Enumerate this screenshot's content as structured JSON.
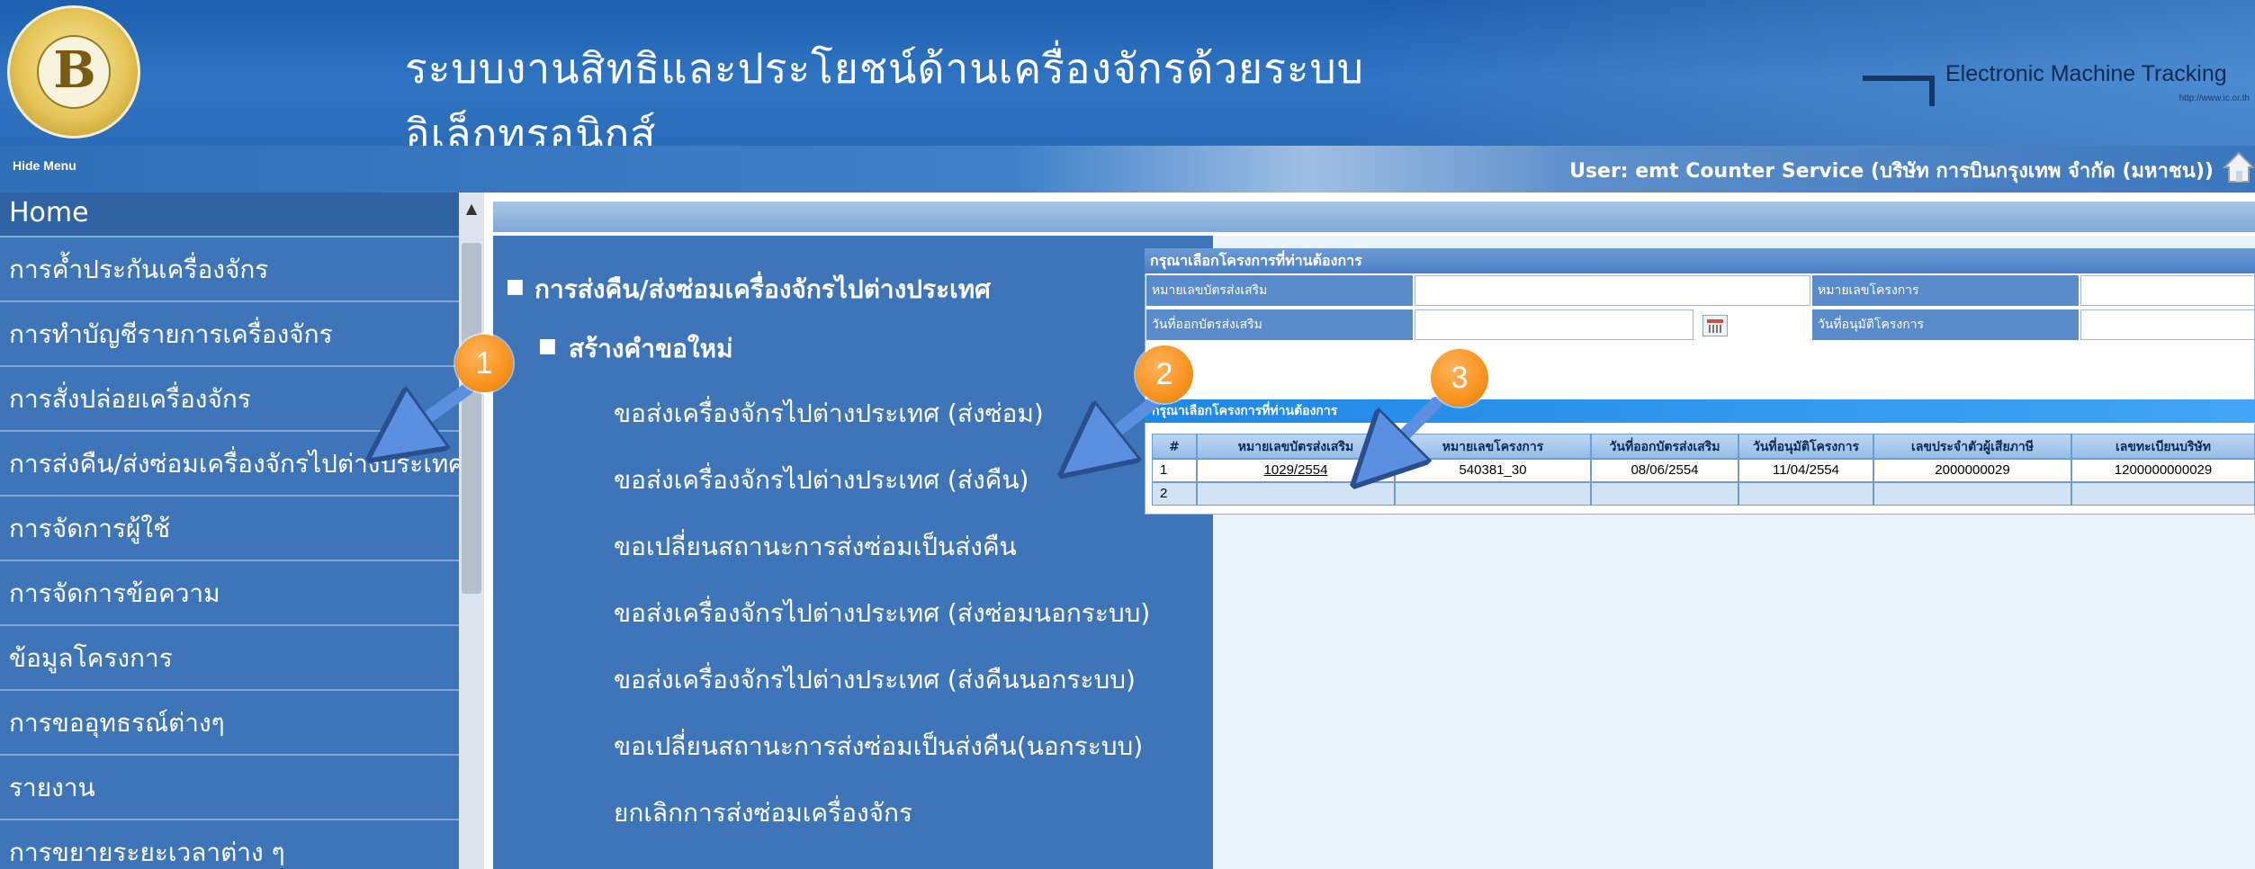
{
  "header": {
    "title": "ระบบงานสิทธิและประโยชน์ด้านเครื่องจักรด้วยระบบอิเล็กทรอนิกส์",
    "brand_title": "Electronic Machine Tracking",
    "brand_url": "http://www.ic.or.th",
    "hide_menu": "Hide Menu",
    "user": "User: emt Counter Service (บริษัท การบินกรุงเทพ จำกัด (มหาชน))"
  },
  "sidebar": {
    "items": [
      {
        "label": "Home"
      },
      {
        "label": "การค้ำประกันเครื่องจักร"
      },
      {
        "label": "การทำบัญชีรายการเครื่องจักร"
      },
      {
        "label": "การสั่งปล่อยเครื่องจักร"
      },
      {
        "label": "การส่งคืน/ส่งซ่อมเครื่องจักรไปต่างประเทศ"
      },
      {
        "label": "การจัดการผู้ใช้"
      },
      {
        "label": "การจัดการข้อความ"
      },
      {
        "label": "ข้อมูลโครงการ"
      },
      {
        "label": "การขออุทธรณ์ต่างๆ"
      },
      {
        "label": "รายงาน"
      },
      {
        "label": "การขยายระยะเวลาต่าง ๆ"
      }
    ]
  },
  "submenu": {
    "section": "การส่งคืน/ส่งซ่อมเครื่องจักรไปต่างประเทศ",
    "group": "สร้างคำขอใหม่",
    "items": [
      {
        "label": "ขอส่งเครื่องจักรไปต่างประเทศ (ส่งซ่อม)"
      },
      {
        "label": "ขอส่งเครื่องจักรไปต่างประเทศ (ส่งคืน)"
      },
      {
        "label": "ขอเปลี่ยนสถานะการส่งซ่อมเป็นส่งคืน"
      },
      {
        "label": "ขอส่งเครื่องจักรไปต่างประเทศ (ส่งซ่อมนอกระบบ)"
      },
      {
        "label": "ขอส่งเครื่องจักรไปต่างประเทศ (ส่งคืนนอกระบบ)"
      },
      {
        "label": "ขอเปลี่ยนสถานะการส่งซ่อมเป็นส่งคืน(นอกระบบ)"
      },
      {
        "label": "ยกเลิกการส่งซ่อมเครื่องจักร"
      }
    ]
  },
  "popup": {
    "title": "กรุณาเลือกโครงการที่ท่านต้องการ",
    "fields": {
      "cert_no_label": "หมายเลขบัตรส่งเสริม",
      "project_no_label": "หมายเลขโครงการ",
      "cert_date_label": "วันที่ออกบัตรส่งเสริม",
      "approve_date_label": "วันที่อนุมัติโครงการ"
    },
    "table_title": "กรุณาเลือกโครงการที่ท่านต้องการ",
    "columns": [
      "#",
      "หมายเลขบัตรส่งเสริม",
      "หมายเลขโครงการ",
      "วันที่ออกบัตรส่งเสริม",
      "วันที่อนุมัติโครงการ",
      "เลขประจำตัวผู้เสียภาษี",
      "เลขทะเบียนบริษัท"
    ],
    "rows": [
      [
        "1",
        "1029/2554",
        "540381_30",
        "08/06/2554",
        "11/04/2554",
        "2000000029",
        "1200000000029"
      ],
      [
        "2",
        "",
        "",
        "",
        "",
        "",
        ""
      ]
    ]
  },
  "callouts": [
    "1",
    "2",
    "3"
  ],
  "colors": {
    "accent": "#3d75b8",
    "callout": "#f7931e",
    "arrow": "#5b8fe0"
  },
  "icons": {
    "home": "home-icon",
    "calendar": "calendar-icon",
    "scroll_up": "scroll-up-icon"
  }
}
